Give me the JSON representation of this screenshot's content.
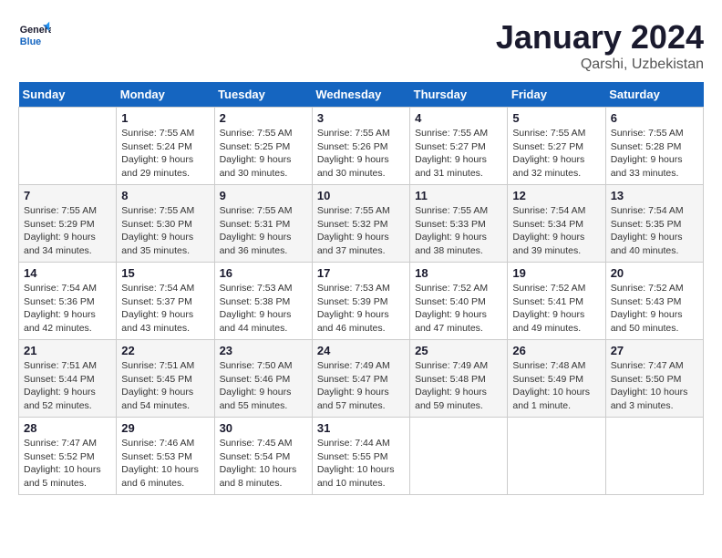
{
  "header": {
    "logo_line1": "General",
    "logo_line2": "Blue",
    "month": "January 2024",
    "location": "Qarshi, Uzbekistan"
  },
  "weekdays": [
    "Sunday",
    "Monday",
    "Tuesday",
    "Wednesday",
    "Thursday",
    "Friday",
    "Saturday"
  ],
  "weeks": [
    [
      {
        "day": "",
        "sunrise": "",
        "sunset": "",
        "daylight": ""
      },
      {
        "day": "1",
        "sunrise": "Sunrise: 7:55 AM",
        "sunset": "Sunset: 5:24 PM",
        "daylight": "Daylight: 9 hours and 29 minutes."
      },
      {
        "day": "2",
        "sunrise": "Sunrise: 7:55 AM",
        "sunset": "Sunset: 5:25 PM",
        "daylight": "Daylight: 9 hours and 30 minutes."
      },
      {
        "day": "3",
        "sunrise": "Sunrise: 7:55 AM",
        "sunset": "Sunset: 5:26 PM",
        "daylight": "Daylight: 9 hours and 30 minutes."
      },
      {
        "day": "4",
        "sunrise": "Sunrise: 7:55 AM",
        "sunset": "Sunset: 5:27 PM",
        "daylight": "Daylight: 9 hours and 31 minutes."
      },
      {
        "day": "5",
        "sunrise": "Sunrise: 7:55 AM",
        "sunset": "Sunset: 5:27 PM",
        "daylight": "Daylight: 9 hours and 32 minutes."
      },
      {
        "day": "6",
        "sunrise": "Sunrise: 7:55 AM",
        "sunset": "Sunset: 5:28 PM",
        "daylight": "Daylight: 9 hours and 33 minutes."
      }
    ],
    [
      {
        "day": "7",
        "sunrise": "Sunrise: 7:55 AM",
        "sunset": "Sunset: 5:29 PM",
        "daylight": "Daylight: 9 hours and 34 minutes."
      },
      {
        "day": "8",
        "sunrise": "Sunrise: 7:55 AM",
        "sunset": "Sunset: 5:30 PM",
        "daylight": "Daylight: 9 hours and 35 minutes."
      },
      {
        "day": "9",
        "sunrise": "Sunrise: 7:55 AM",
        "sunset": "Sunset: 5:31 PM",
        "daylight": "Daylight: 9 hours and 36 minutes."
      },
      {
        "day": "10",
        "sunrise": "Sunrise: 7:55 AM",
        "sunset": "Sunset: 5:32 PM",
        "daylight": "Daylight: 9 hours and 37 minutes."
      },
      {
        "day": "11",
        "sunrise": "Sunrise: 7:55 AM",
        "sunset": "Sunset: 5:33 PM",
        "daylight": "Daylight: 9 hours and 38 minutes."
      },
      {
        "day": "12",
        "sunrise": "Sunrise: 7:54 AM",
        "sunset": "Sunset: 5:34 PM",
        "daylight": "Daylight: 9 hours and 39 minutes."
      },
      {
        "day": "13",
        "sunrise": "Sunrise: 7:54 AM",
        "sunset": "Sunset: 5:35 PM",
        "daylight": "Daylight: 9 hours and 40 minutes."
      }
    ],
    [
      {
        "day": "14",
        "sunrise": "Sunrise: 7:54 AM",
        "sunset": "Sunset: 5:36 PM",
        "daylight": "Daylight: 9 hours and 42 minutes."
      },
      {
        "day": "15",
        "sunrise": "Sunrise: 7:54 AM",
        "sunset": "Sunset: 5:37 PM",
        "daylight": "Daylight: 9 hours and 43 minutes."
      },
      {
        "day": "16",
        "sunrise": "Sunrise: 7:53 AM",
        "sunset": "Sunset: 5:38 PM",
        "daylight": "Daylight: 9 hours and 44 minutes."
      },
      {
        "day": "17",
        "sunrise": "Sunrise: 7:53 AM",
        "sunset": "Sunset: 5:39 PM",
        "daylight": "Daylight: 9 hours and 46 minutes."
      },
      {
        "day": "18",
        "sunrise": "Sunrise: 7:52 AM",
        "sunset": "Sunset: 5:40 PM",
        "daylight": "Daylight: 9 hours and 47 minutes."
      },
      {
        "day": "19",
        "sunrise": "Sunrise: 7:52 AM",
        "sunset": "Sunset: 5:41 PM",
        "daylight": "Daylight: 9 hours and 49 minutes."
      },
      {
        "day": "20",
        "sunrise": "Sunrise: 7:52 AM",
        "sunset": "Sunset: 5:43 PM",
        "daylight": "Daylight: 9 hours and 50 minutes."
      }
    ],
    [
      {
        "day": "21",
        "sunrise": "Sunrise: 7:51 AM",
        "sunset": "Sunset: 5:44 PM",
        "daylight": "Daylight: 9 hours and 52 minutes."
      },
      {
        "day": "22",
        "sunrise": "Sunrise: 7:51 AM",
        "sunset": "Sunset: 5:45 PM",
        "daylight": "Daylight: 9 hours and 54 minutes."
      },
      {
        "day": "23",
        "sunrise": "Sunrise: 7:50 AM",
        "sunset": "Sunset: 5:46 PM",
        "daylight": "Daylight: 9 hours and 55 minutes."
      },
      {
        "day": "24",
        "sunrise": "Sunrise: 7:49 AM",
        "sunset": "Sunset: 5:47 PM",
        "daylight": "Daylight: 9 hours and 57 minutes."
      },
      {
        "day": "25",
        "sunrise": "Sunrise: 7:49 AM",
        "sunset": "Sunset: 5:48 PM",
        "daylight": "Daylight: 9 hours and 59 minutes."
      },
      {
        "day": "26",
        "sunrise": "Sunrise: 7:48 AM",
        "sunset": "Sunset: 5:49 PM",
        "daylight": "Daylight: 10 hours and 1 minute."
      },
      {
        "day": "27",
        "sunrise": "Sunrise: 7:47 AM",
        "sunset": "Sunset: 5:50 PM",
        "daylight": "Daylight: 10 hours and 3 minutes."
      }
    ],
    [
      {
        "day": "28",
        "sunrise": "Sunrise: 7:47 AM",
        "sunset": "Sunset: 5:52 PM",
        "daylight": "Daylight: 10 hours and 5 minutes."
      },
      {
        "day": "29",
        "sunrise": "Sunrise: 7:46 AM",
        "sunset": "Sunset: 5:53 PM",
        "daylight": "Daylight: 10 hours and 6 minutes."
      },
      {
        "day": "30",
        "sunrise": "Sunrise: 7:45 AM",
        "sunset": "Sunset: 5:54 PM",
        "daylight": "Daylight: 10 hours and 8 minutes."
      },
      {
        "day": "31",
        "sunrise": "Sunrise: 7:44 AM",
        "sunset": "Sunset: 5:55 PM",
        "daylight": "Daylight: 10 hours and 10 minutes."
      },
      {
        "day": "",
        "sunrise": "",
        "sunset": "",
        "daylight": ""
      },
      {
        "day": "",
        "sunrise": "",
        "sunset": "",
        "daylight": ""
      },
      {
        "day": "",
        "sunrise": "",
        "sunset": "",
        "daylight": ""
      }
    ]
  ]
}
